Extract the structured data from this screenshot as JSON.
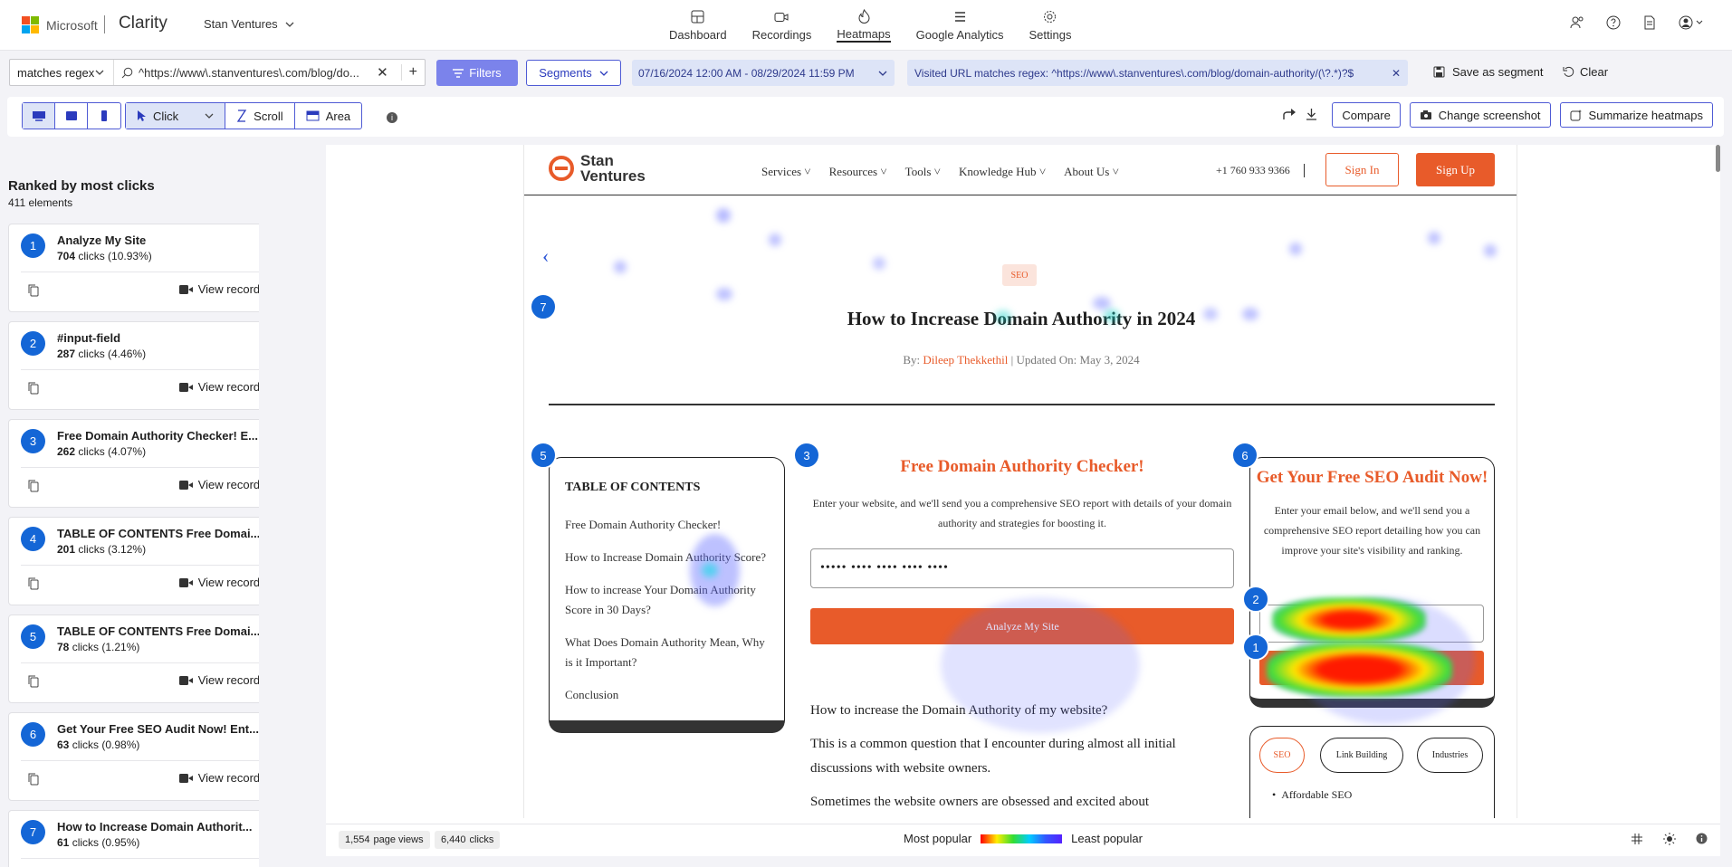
{
  "header": {
    "brand": "Microsoft",
    "product": "Clarity",
    "project": "Stan Ventures",
    "nav": [
      {
        "label": "Dashboard",
        "icon": "dashboard-icon"
      },
      {
        "label": "Recordings",
        "icon": "video-icon"
      },
      {
        "label": "Heatmaps",
        "icon": "flame-icon",
        "active": true
      },
      {
        "label": "Google Analytics",
        "icon": "analytics-icon"
      },
      {
        "label": "Settings",
        "icon": "gear-icon"
      }
    ]
  },
  "filters": {
    "operator": "matches regex",
    "url_value": "^https://www\\.stanventures\\.com/blog/do...",
    "filters_label": "Filters",
    "segments_label": "Segments",
    "date_range": "07/16/2024 12:00 AM - 08/29/2024 11:59 PM",
    "url_chip": "Visited URL matches regex: ^https://www\\.stanventures\\.com/blog/domain-authority/(\\?.*)?$",
    "save_segment": "Save as segment",
    "clear": "Clear"
  },
  "toolbar": {
    "modes": [
      "Click",
      "Scroll",
      "Area"
    ],
    "compare": "Compare",
    "change_screenshot": "Change screenshot",
    "summarize": "Summarize heatmaps"
  },
  "sidebar": {
    "title": "Ranked by most clicks",
    "count": "411 elements",
    "view_recordings": "View recordings",
    "items": [
      {
        "rank": "1",
        "name": "Analyze My Site",
        "clicks": "704",
        "pct": "clicks (10.93%)"
      },
      {
        "rank": "2",
        "name": "#input-field",
        "clicks": "287",
        "pct": "clicks (4.46%)"
      },
      {
        "rank": "3",
        "name": "Free Domain Authority Checker! E...",
        "clicks": "262",
        "pct": "clicks (4.07%)"
      },
      {
        "rank": "4",
        "name": "TABLE OF CONTENTS Free Domai...",
        "clicks": "201",
        "pct": "clicks (3.12%)"
      },
      {
        "rank": "5",
        "name": "TABLE OF CONTENTS Free Domai...",
        "clicks": "78",
        "pct": "clicks (1.21%)"
      },
      {
        "rank": "6",
        "name": "Get Your Free SEO Audit Now! Ent...",
        "clicks": "63",
        "pct": "clicks (0.98%)"
      },
      {
        "rank": "7",
        "name": "How to Increase Domain Authorit...",
        "clicks": "61",
        "pct": "clicks (0.95%)"
      }
    ]
  },
  "site": {
    "logo_line1": "Stan",
    "logo_line2": "Ventures",
    "nav": [
      "Services",
      "Resources",
      "Tools",
      "Knowledge Hub",
      "About Us"
    ],
    "phone": "+1 760 933 9366",
    "sign_in": "Sign In",
    "sign_up": "Sign Up",
    "tag": "SEO",
    "title": "How to Increase Domain Authority in 2024",
    "by": "By:",
    "author": "Dileep Thekkethil",
    "updated": "| Updated On: May 3, 2024",
    "toc_title": "TABLE OF CONTENTS",
    "toc": [
      "Free Domain Authority Checker!",
      "How to Increase Domain Authority Score?",
      "How to increase Your Domain Authority Score in 30 Days?",
      "What Does Domain Authority Mean, Why is it Important?",
      "Conclusion"
    ],
    "checker_title": "Free Domain Authority Checker!",
    "checker_desc": "Enter your website, and we'll send you a comprehensive SEO report with details of your domain authority and strategies for boosting it.",
    "checker_input": "••••• •••• •••• •••• ••••",
    "checker_button": "Analyze My Site",
    "body_q": "How to increase the Domain Authority of my website?",
    "body_p1": "This is a common question that I encounter during almost all initial discussions with website owners.",
    "body_p2": "Sometimes the website owners are obsessed and excited about",
    "audit_title": "Get Your Free SEO Audit Now!",
    "audit_desc": "Enter your email below, and we'll send you a comprehensive SEO report detailing how you can improve your site's visibility and ranking.",
    "tags": [
      "SEO",
      "Link Building",
      "Industries"
    ],
    "afford": "Affordable SEO"
  },
  "bottom": {
    "page_views": "1,554",
    "page_views_label": "page views",
    "clicks": "6,440",
    "clicks_label": "clicks",
    "most": "Most popular",
    "least": "Least popular"
  }
}
